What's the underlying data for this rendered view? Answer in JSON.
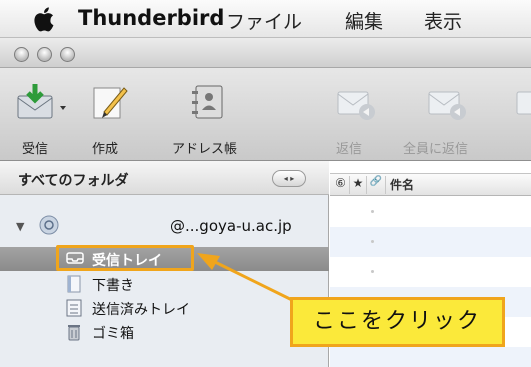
{
  "menubar": {
    "app_name": "Thunderbird",
    "items": [
      "ファイル",
      "編集",
      "表示"
    ]
  },
  "titlebar": {
    "buttons": [
      "close",
      "minimize",
      "zoom"
    ]
  },
  "toolbar": {
    "buttons": [
      {
        "label": "受信",
        "icon": "get-mail-icon",
        "enabled": true
      },
      {
        "label": "作成",
        "icon": "write-icon",
        "enabled": true
      },
      {
        "label": "アドレス帳",
        "icon": "address-book-icon",
        "enabled": true
      },
      {
        "label": "返信",
        "icon": "reply-icon",
        "enabled": false
      },
      {
        "label": "全員に返信",
        "icon": "reply-all-icon",
        "enabled": false
      }
    ]
  },
  "sidebar": {
    "header": "すべてのフォルダ",
    "view_switch": "◂ ▸",
    "account": "@...goya-u.ac.jp",
    "folders": [
      {
        "label": "受信トレイ",
        "icon": "inbox-icon",
        "selected": true
      },
      {
        "label": "下書き",
        "icon": "drafts-icon",
        "selected": false
      },
      {
        "label": "送信済みトレイ",
        "icon": "sent-icon",
        "selected": false
      },
      {
        "label": "ゴミ箱",
        "icon": "trash-icon",
        "selected": false
      }
    ]
  },
  "message_list": {
    "columns": [
      "⑥",
      "★",
      "🔗",
      "件名"
    ]
  },
  "callout": {
    "text": "ここをクリック",
    "colors": {
      "fill": "#fbe93a",
      "border": "#f0a51c"
    }
  },
  "colors": {
    "selection": "#999999",
    "sidebar_bg": "#e9edf2"
  }
}
